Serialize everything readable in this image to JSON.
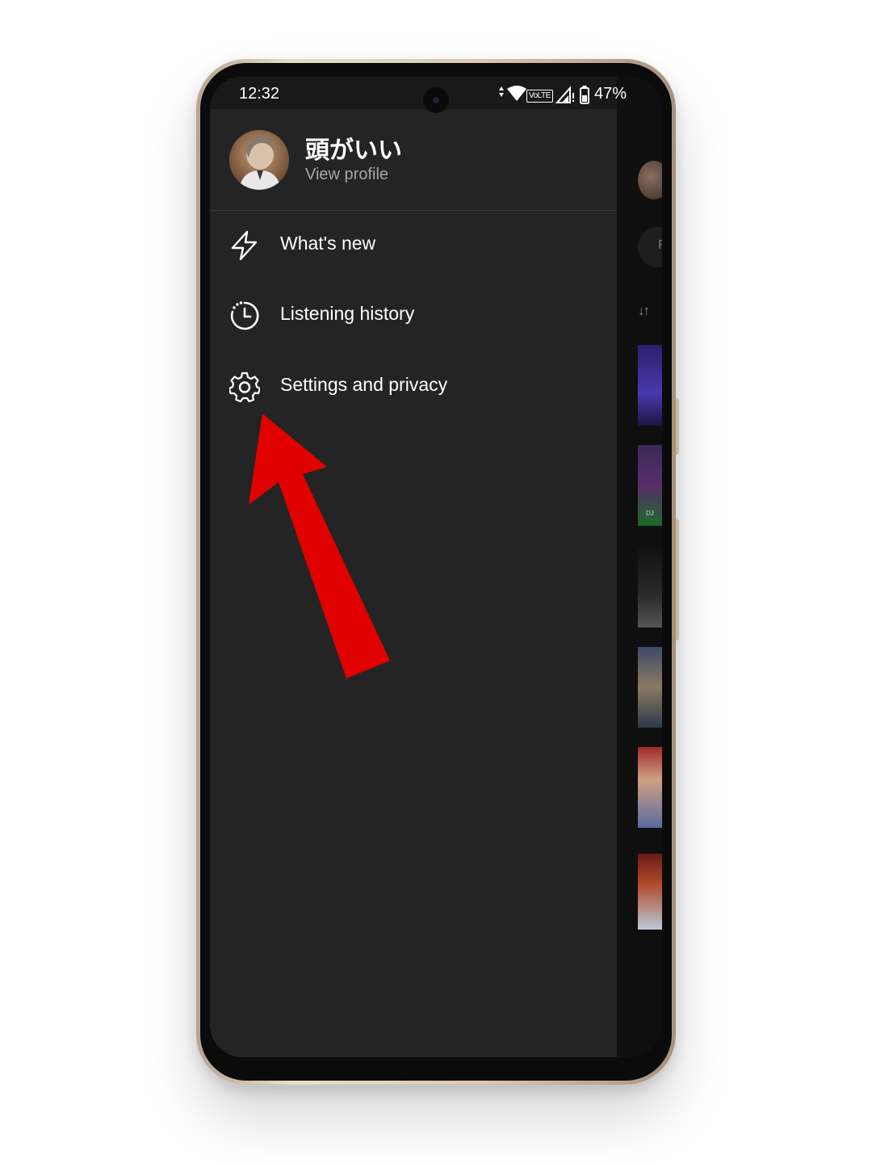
{
  "status_bar": {
    "time": "12:32",
    "volte": "VoLTE",
    "battery": "47%"
  },
  "profile": {
    "name": "頭がいい",
    "subtitle": "View profile"
  },
  "menu": {
    "items": [
      {
        "label": "What's new",
        "icon": "lightning-bolt-icon"
      },
      {
        "label": "Listening history",
        "icon": "history-clock-icon"
      },
      {
        "label": "Settings and privacy",
        "icon": "gear-icon"
      }
    ]
  },
  "background": {
    "chip_text": "F",
    "sort_icon": "↓↑",
    "thumb_label": "DJ"
  },
  "colors": {
    "drawer": "#242424",
    "annotation_arrow": "#e00000",
    "text_primary": "#ffffff",
    "text_secondary": "#a7a7a7"
  }
}
